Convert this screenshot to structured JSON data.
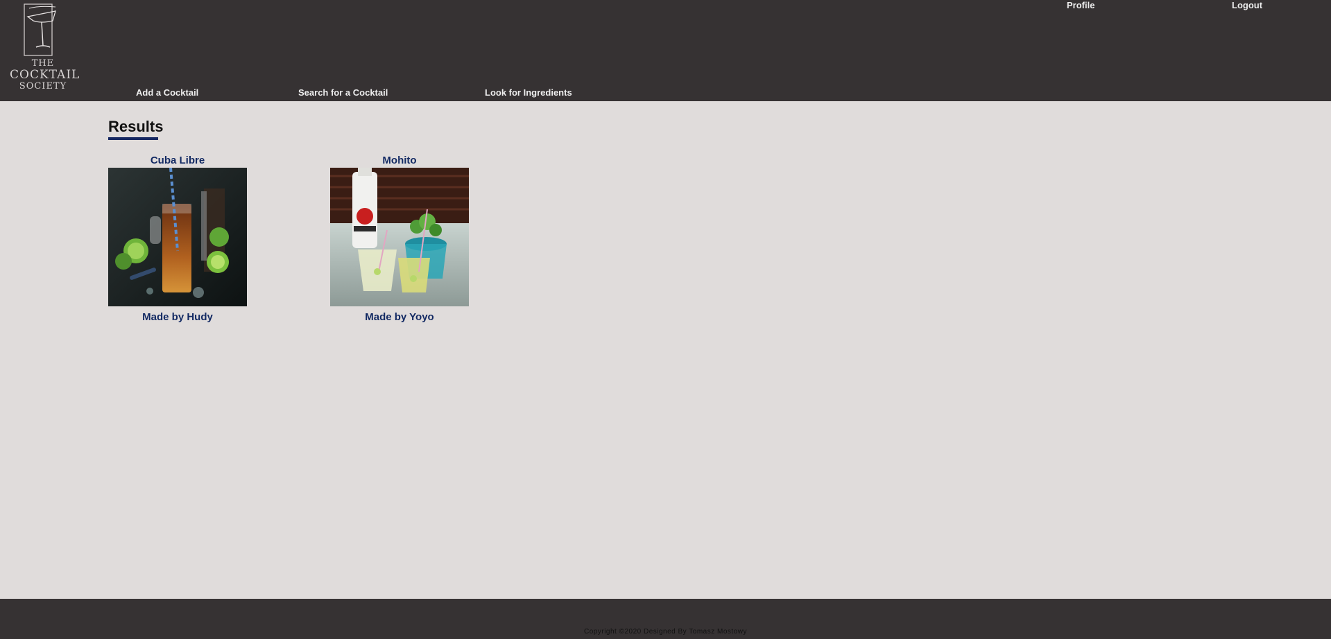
{
  "header": {
    "logo": {
      "line1": "THE",
      "line2": "COCKTAIL",
      "line3": "SOCIETY"
    },
    "nav": {
      "add_cocktail": "Add a Cocktail",
      "search_cocktail": "Search for a Cocktail",
      "ingredients": "Look for Ingredients"
    },
    "user_menu": {
      "profile": "Profile",
      "logout": "Logout"
    }
  },
  "main": {
    "title": "Results",
    "results": [
      {
        "name": "Cuba Libre",
        "author": "Made by Hudy"
      },
      {
        "name": "Mohito",
        "author": "Made by Yoyo"
      }
    ]
  },
  "footer": {
    "copyright": "Copyright ©2020 Designed By Tomasz Mostowy"
  },
  "colors": {
    "header_bg": "#363233",
    "page_bg": "#e0dcdb",
    "accent": "#152761",
    "link_text": "#132a63"
  }
}
